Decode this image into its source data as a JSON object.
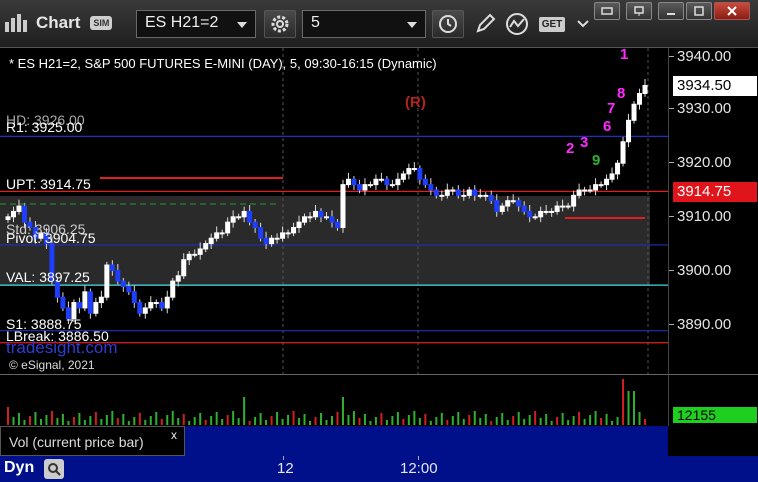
{
  "toolbar": {
    "app_name": "Chart",
    "sim_badge": "SIM",
    "symbol": "ES H21=2",
    "interval": "5",
    "quote_button": "GET"
  },
  "chart": {
    "header": "* ES H21=2, S&P 500 FUTURES E-MINI (DAY), 5, 09:30-16:15 (Dynamic)",
    "r_marker": "(R)",
    "watermark": "tradesight.com",
    "copyright": "© eSignal, 2021",
    "levels": [
      {
        "label": "R1: 3925.00",
        "overlap": "HD: 3926.00",
        "price": 3925.0,
        "color": "#1f2fbf"
      },
      {
        "label": "UPT: 3914.75",
        "price": 3914.75,
        "color": "#e02020"
      },
      {
        "label": "Pivot: 3904.75",
        "overlap": "Std: 3906.25",
        "price": 3904.75,
        "color": "#1f2fbf"
      },
      {
        "label": "VAL: 3897.25",
        "price": 3897.25,
        "color": "#3fd8e0"
      },
      {
        "label": "S1: 3888.75",
        "price": 3888.75,
        "color": "#1f2fbf"
      },
      {
        "label": "LBreak: 3886.50",
        "price": 3886.5,
        "color": "#e02020"
      }
    ],
    "sequence_numbers": [
      "1",
      "2",
      "3",
      "6",
      "7",
      "8",
      "9"
    ]
  },
  "price_axis": {
    "ticks": [
      "3940.00",
      "3930.00",
      "3920.00",
      "3910.00",
      "3900.00",
      "3890.00"
    ],
    "last_price": "3934.50",
    "upt_price": "3914.75"
  },
  "volume": {
    "study_label": "Vol (current price bar)",
    "close_label": "x",
    "current": "12155"
  },
  "time_axis": {
    "dyn_label": "Dyn",
    "ticks": [
      "12",
      "12:00"
    ]
  },
  "chart_data": {
    "type": "candlestick",
    "y_range": [
      3880,
      3945
    ],
    "closes": [
      3910,
      3911,
      3912,
      3909,
      3908,
      3906,
      3907,
      3905,
      3898,
      3895,
      3893,
      3891,
      3894,
      3893,
      3896,
      3892,
      3894,
      3895,
      3901,
      3900,
      3898,
      3897,
      3896,
      3894,
      3892,
      3893,
      3894,
      3894,
      3893,
      3895,
      3898,
      3899,
      3902,
      3903,
      3903,
      3904,
      3905,
      3906,
      3907,
      3907,
      3909,
      3910,
      3910,
      3911,
      3909,
      3908,
      3906,
      3905,
      3906,
      3906,
      3907,
      3907,
      3908,
      3909,
      3910,
      3910,
      3911,
      3910,
      3910,
      3909,
      3908,
      3916,
      3917,
      3916,
      3915,
      3916,
      3916,
      3917,
      3917,
      3916,
      3916,
      3917,
      3918,
      3919,
      3919,
      3917,
      3916,
      3915,
      3914,
      3914,
      3915,
      3915,
      3914,
      3914,
      3915,
      3914,
      3914,
      3914,
      3913,
      3911,
      3912,
      3913,
      3913,
      3912,
      3911,
      3910,
      3910,
      3911,
      3911,
      3911,
      3912,
      3912,
      3912,
      3914,
      3915,
      3915,
      3915,
      3916,
      3916,
      3917,
      3918,
      3920,
      3924,
      3928,
      3931,
      3933,
      3934.5
    ],
    "volume_current": 12155,
    "levels": [
      3926,
      3925,
      3914.75,
      3906.25,
      3904.75,
      3897.25,
      3888.75,
      3886.5
    ]
  }
}
